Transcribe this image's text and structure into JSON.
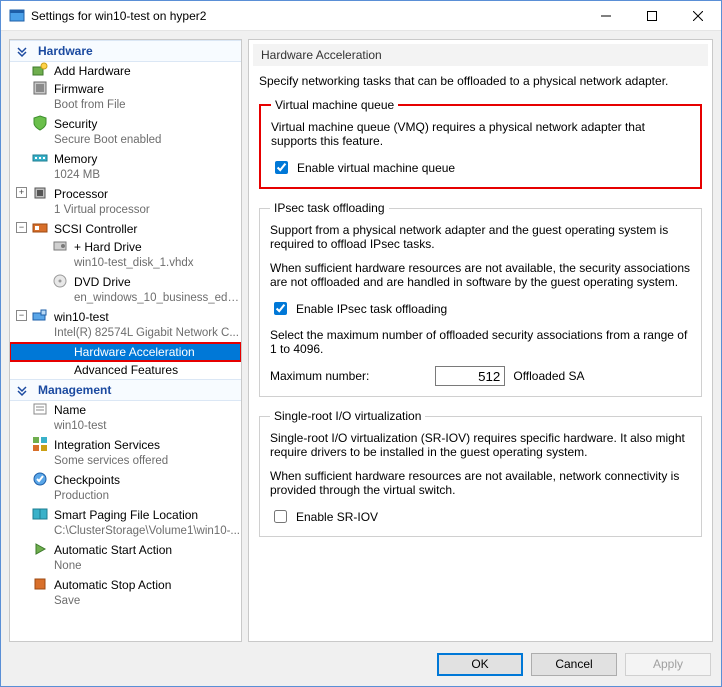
{
  "window": {
    "title": "Settings for win10-test on hyper2",
    "buttons": {
      "ok": "OK",
      "cancel": "Cancel",
      "apply": "Apply"
    }
  },
  "sidebar": {
    "cat_hardware": "Hardware",
    "cat_management": "Management",
    "add_hardware": "Add Hardware",
    "firmware": {
      "label": "Firmware",
      "sub": "Boot from File"
    },
    "security": {
      "label": "Security",
      "sub": "Secure Boot enabled"
    },
    "memory": {
      "label": "Memory",
      "sub": "1024 MB"
    },
    "processor": {
      "label": "Processor",
      "sub": "1 Virtual processor"
    },
    "scsi": {
      "label": "SCSI Controller"
    },
    "hard_drive": {
      "label": "Hard Drive",
      "sub": "win10-test_disk_1.vhdx"
    },
    "dvd": {
      "label": "DVD Drive",
      "sub": "en_windows_10_business_editi..."
    },
    "nic": {
      "label": "win10-test",
      "sub": "Intel(R) 82574L Gigabit Network C..."
    },
    "hw_accel": "Hardware Acceleration",
    "adv_feat": "Advanced Features",
    "name": {
      "label": "Name",
      "sub": "win10-test"
    },
    "integ": {
      "label": "Integration Services",
      "sub": "Some services offered"
    },
    "checkpoints": {
      "label": "Checkpoints",
      "sub": "Production"
    },
    "paging": {
      "label": "Smart Paging File Location",
      "sub": "C:\\ClusterStorage\\Volume1\\win10-..."
    },
    "autostart": {
      "label": "Automatic Start Action",
      "sub": "None"
    },
    "autostop": {
      "label": "Automatic Stop Action",
      "sub": "Save"
    }
  },
  "content": {
    "panel_title": "Hardware Acceleration",
    "intro": "Specify networking tasks that can be offloaded to a physical network adapter.",
    "vmq": {
      "legend": "Virtual machine queue",
      "text": "Virtual machine queue (VMQ) requires a physical network adapter that supports this feature.",
      "checkbox": "Enable virtual machine queue",
      "checked": true
    },
    "ipsec": {
      "legend": "IPsec task offloading",
      "text1": "Support from a physical network adapter and the guest operating system is required to offload IPsec tasks.",
      "text2": "When sufficient hardware resources are not available, the security associations are not offloaded and are handled in software by the guest operating system.",
      "checkbox": "Enable IPsec task offloading",
      "checked": true,
      "select_text": "Select the maximum number of offloaded security associations from a range of 1 to 4096.",
      "max_label": "Maximum number:",
      "max_value": "512",
      "suffix": "Offloaded SA"
    },
    "sriov": {
      "legend": "Single-root I/O virtualization",
      "text1": "Single-root I/O virtualization (SR-IOV) requires specific hardware. It also might require drivers to be installed in the guest operating system.",
      "text2": "When sufficient hardware resources are not available, network connectivity is provided through the virtual switch.",
      "checkbox": "Enable SR-IOV",
      "checked": false
    }
  }
}
